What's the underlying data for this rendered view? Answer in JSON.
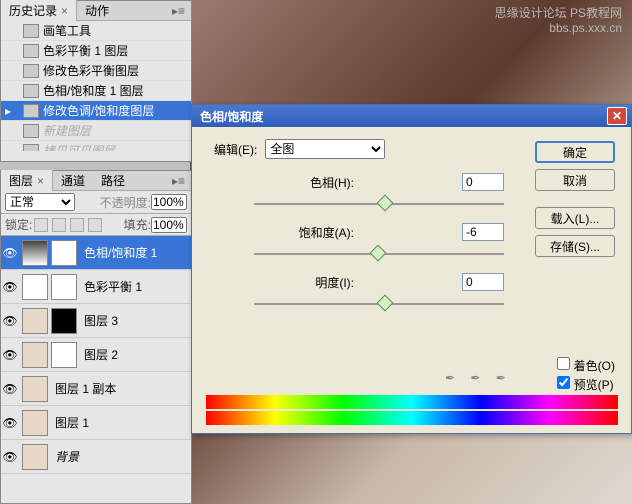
{
  "watermark": {
    "line1": "思缘设计论坛  PS教程网",
    "line2": "bbs.ps.xxx.cn"
  },
  "history": {
    "tabs": [
      "历史记录",
      "动作"
    ],
    "items": [
      {
        "label": "画笔工具"
      },
      {
        "label": "色彩平衡 1 图层"
      },
      {
        "label": "修改色彩平衡图层"
      },
      {
        "label": "色相/饱和度 1 图层"
      },
      {
        "label": "修改色调/饱和度图层",
        "selected": true
      },
      {
        "label": "新建图层",
        "dim": true
      },
      {
        "label": "拷贝可见图层",
        "dim": true
      }
    ]
  },
  "layers": {
    "tabs": [
      "图层",
      "通道",
      "路径"
    ],
    "mode_label": "正常",
    "opacity_label": "不透明度:",
    "opacity_value": "100%",
    "lock_label": "锁定:",
    "fill_label": "填充:",
    "fill_value": "100%",
    "items": [
      {
        "name": "色相/饱和度 1",
        "selected": true
      },
      {
        "name": "色彩平衡 1"
      },
      {
        "name": "图层 3"
      },
      {
        "name": "图层 2"
      },
      {
        "name": "图层 1 副本"
      },
      {
        "name": "图层 1"
      },
      {
        "name": "背景",
        "italic": true
      }
    ]
  },
  "dialog": {
    "title": "色相/饱和度",
    "edit_label": "编辑(E):",
    "edit_value": "全图",
    "hue_label": "色相(H):",
    "hue_value": "0",
    "sat_label": "饱和度(A):",
    "sat_value": "-6",
    "light_label": "明度(I):",
    "light_value": "0",
    "buttons": {
      "ok": "确定",
      "cancel": "取消",
      "load": "载入(L)...",
      "save": "存储(S)..."
    },
    "colorize_label": "着色(O)",
    "preview_label": "预览(P)"
  }
}
